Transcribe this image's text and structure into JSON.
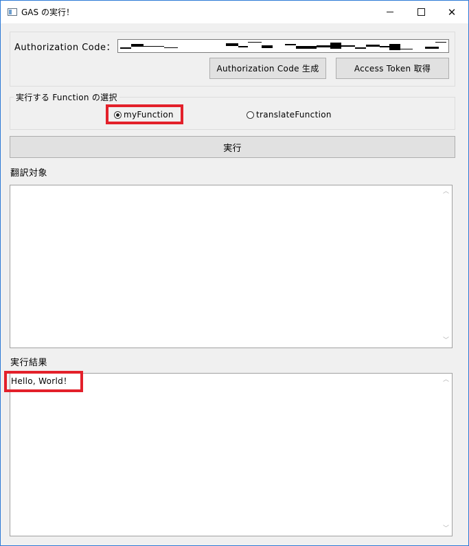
{
  "window": {
    "title": "GAS の実行！"
  },
  "auth": {
    "label": "Authorization Code：",
    "code_value": "",
    "generate_button": "Authorization Code 生成",
    "token_button": "Access Token 取得"
  },
  "function_group": {
    "legend": "実行する Function の選択",
    "options": [
      {
        "label": "myFunction",
        "checked": true
      },
      {
        "label": "translateFunction",
        "checked": false
      }
    ]
  },
  "run_button": "実行",
  "target": {
    "label": "翻訳対象",
    "value": ""
  },
  "result": {
    "label": "実行結果",
    "value": "Hello, World！"
  },
  "colors": {
    "highlight": "#e3202a",
    "window_border": "#2b79d6",
    "background": "#f0f0f0"
  },
  "icons": [
    "app-icon",
    "minimize-icon",
    "maximize-icon",
    "close-icon",
    "chevron-up-icon",
    "chevron-down-icon"
  ]
}
